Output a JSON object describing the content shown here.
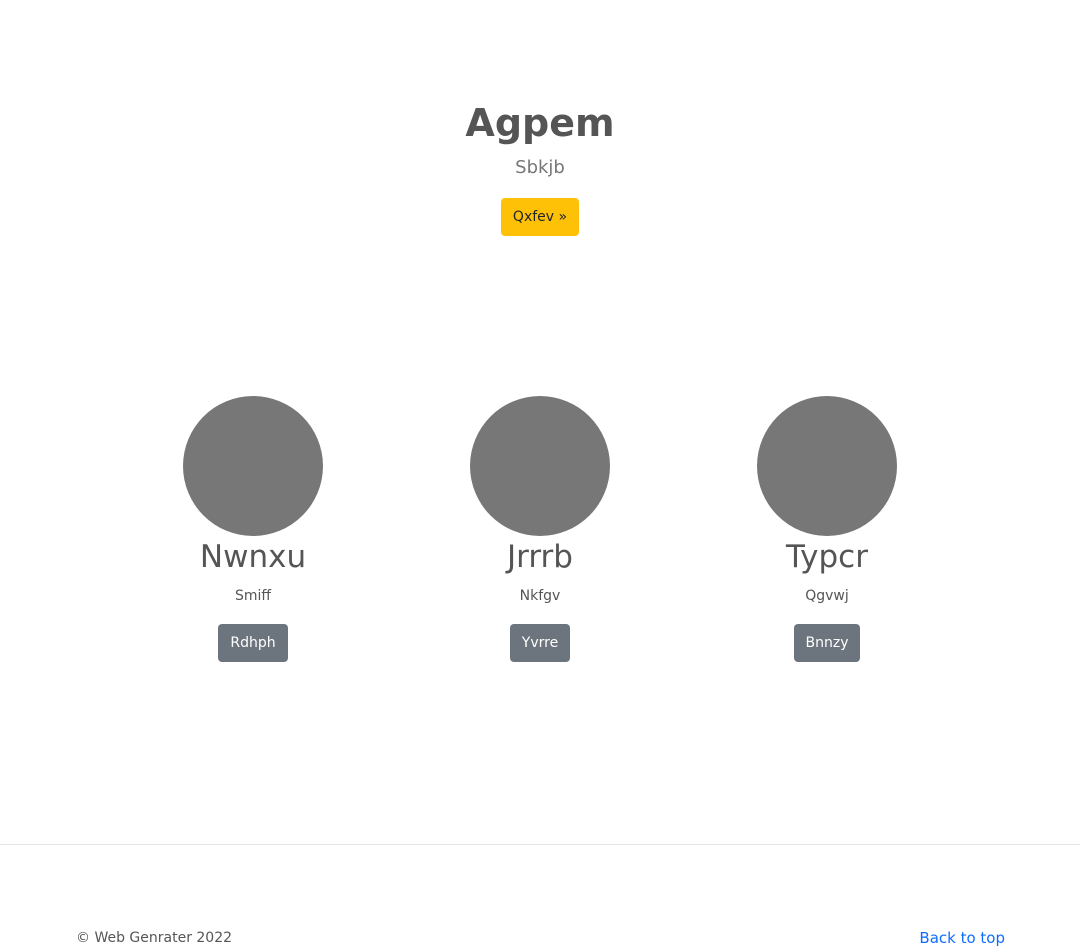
{
  "hero": {
    "title": "Agpem",
    "subtitle": "Sbkjb",
    "button_label": "Qxfev »"
  },
  "cards": [
    {
      "name": "Nwnxu",
      "description": "Smiff",
      "button_label": "Rdhph"
    },
    {
      "name": "Jrrrb",
      "description": "Nkfgv",
      "button_label": "Yvrre"
    },
    {
      "name": "Typcr",
      "description": "Qgvwj",
      "button_label": "Bnnzy"
    }
  ],
  "footer": {
    "copyright": "© Web Genrater 2022",
    "back_to_top": "Back to top"
  },
  "colors": {
    "accent_button": "#ffc107",
    "secondary_button": "#6c757d",
    "avatar_placeholder": "#777777",
    "link": "#0d6efd"
  }
}
